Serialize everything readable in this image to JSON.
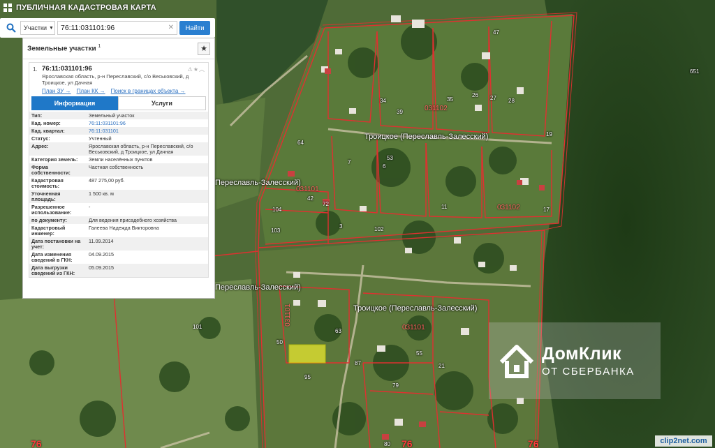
{
  "header": {
    "title": "ПУБЛИЧНАЯ КАДАСТРОВАЯ КАРТА"
  },
  "search": {
    "type_select": "Участки",
    "query": "76:11:031101:96",
    "button": "Найти"
  },
  "panel": {
    "title": "Земельные участки",
    "title_sup": "1",
    "item": {
      "number": "1.",
      "cad_id": "76:11:031101:96",
      "address": "Ярославская область, р-н Переславский, с/о Веськовский, д Троицкое, ул Дачная",
      "links": [
        "План ЗУ →",
        "План КК →",
        "Поиск в границах объекта →"
      ]
    },
    "tabs": [
      "Информация",
      "Услуги"
    ],
    "fields": [
      {
        "k": "Тип:",
        "v": "Земельный участок"
      },
      {
        "k": "Кад. номер:",
        "v": "76:11:031101:96",
        "link": true
      },
      {
        "k": "Кад. квартал:",
        "v": "76:11:031101",
        "link": true
      },
      {
        "k": "Статус:",
        "v": "Учтенный"
      },
      {
        "k": "Адрес:",
        "v": "Ярославская область, р-н Переславский, с/о Веськовский, д Троицкое, ул Дачная"
      },
      {
        "k": "Категория земель:",
        "v": "Земли населённых пунктов"
      },
      {
        "k": "Форма собственности:",
        "v": "Частная собственность"
      },
      {
        "k": "Кадастровая стоимость:",
        "v": "487 275,00 руб."
      },
      {
        "k": "Уточненная площадь:",
        "v": "1 500 кв. м"
      },
      {
        "k": "Разрешенное использование:",
        "v": "-"
      },
      {
        "k": "по документу:",
        "v": "Для ведения присадебного хозяйства"
      },
      {
        "k": "Кадастровый инженер:",
        "v": "Галеева Надежда Викторовна"
      },
      {
        "k": "Дата постановки на учет:",
        "v": "11.09.2014"
      },
      {
        "k": "Дата изменения сведений в ГКН:",
        "v": "04.09.2015"
      },
      {
        "k": "Дата выгрузки сведений из ГКН:",
        "v": "05.09.2015"
      }
    ]
  },
  "map": {
    "place_labels": [
      "Троицкое (Переславль-Залесский)",
      "Троицкое (Переславль-Залесский)",
      "Переславль-Залесский)",
      "Переславль-Залесский)"
    ],
    "quarter_labels": [
      "031102",
      "031101",
      "031102",
      "031101",
      "031101"
    ],
    "region_labels": [
      "76",
      "76",
      "76"
    ],
    "parcel_numbers": [
      "47",
      "651",
      "101",
      "95",
      "50",
      "87",
      "79",
      "80",
      "104",
      "103",
      "72",
      "42",
      "64",
      "35",
      "39",
      "26",
      "27",
      "28",
      "19",
      "17",
      "21",
      "102",
      "34",
      "55",
      "63",
      "53",
      "7",
      "6",
      "3",
      "11"
    ]
  },
  "watermark": {
    "line1": "ДомКлик",
    "line2": "ОТ СБЕРБАНКА"
  },
  "credit": "clip2net.com",
  "colors": {
    "accent": "#1f78c8",
    "boundary": "#e03030",
    "selected_parcel": "#e8e830"
  }
}
